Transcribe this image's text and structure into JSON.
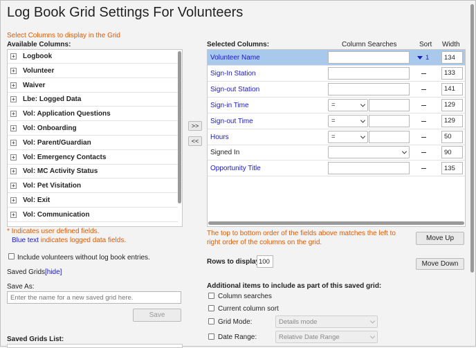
{
  "page": {
    "title": "Log Book Grid Settings For Volunteers"
  },
  "left": {
    "instruction": "Select Columns to display in the Grid",
    "available_label": "Available Columns:",
    "available_items": [
      "Logbook",
      "Volunteer",
      "Waiver",
      "Lbe: Logged Data",
      "Vol: Application Questions",
      "Vol: Onboarding",
      "Vol: Parent/Guardian",
      "Vol: Emergency Contacts",
      "Vol: MC Activity Status",
      "Vol: Pet Visitation",
      "Vol: Exit",
      "Vol: Communication"
    ],
    "note_user_defined": "* Indicates user defined fields.",
    "note_blue_text": "Blue text",
    "note_logged": " indicates logged data fields.",
    "include_without_entries_label": "Include volunteers without log book entries.",
    "saved_grids_label": "Saved Grids",
    "hide_link": "[hide]",
    "save_as_label": "Save As:",
    "save_as_placeholder": "Enter the name for a new saved grid here.",
    "save_button": "Save",
    "saved_grids_list_label": "Saved Grids List:"
  },
  "move_buttons": {
    "add": ">>",
    "remove": "<<"
  },
  "right": {
    "selected_label": "Selected Columns:",
    "headers": {
      "searches": "Column Searches",
      "sort": "Sort",
      "width": "Width"
    },
    "rows": [
      {
        "name": "Volunteer Name",
        "logged": true,
        "search": "text",
        "sort": "1",
        "width": "134",
        "selected": true
      },
      {
        "name": "Sign-In Station",
        "logged": true,
        "search": "text",
        "width": "133"
      },
      {
        "name": "Sign-out Station",
        "logged": true,
        "search": "text",
        "width": "141"
      },
      {
        "name": "Sign-in Time",
        "logged": true,
        "search": "op",
        "op": "=",
        "width": "129"
      },
      {
        "name": "Sign-out Time",
        "logged": true,
        "search": "op",
        "op": "=",
        "width": "129"
      },
      {
        "name": "Hours",
        "logged": true,
        "search": "op",
        "op": "=",
        "width": "50"
      },
      {
        "name": "Signed In",
        "logged": false,
        "search": "select",
        "width": "90"
      },
      {
        "name": "Opportunity Title",
        "logged": true,
        "search": "text",
        "width": "135"
      }
    ],
    "order_note": "The top to bottom order of the fields above matches the left to right order of the columns on the grid.",
    "move_up": "Move Up",
    "move_down": "Move Down",
    "rows_to_display_label": "Rows to display:",
    "rows_to_display_value": "100",
    "additional_label": "Additional items to include as part of this saved grid:",
    "opt_column_searches": "Column searches",
    "opt_current_sort": "Current column sort",
    "opt_grid_mode": "Grid Mode:",
    "grid_mode_value": "Details mode",
    "opt_date_range": "Date Range:",
    "date_range_value": "Relative Date Range"
  },
  "colors": {
    "accent_orange": "#e05a00",
    "logged_blue": "#1818c8",
    "selected_row": "#a9c9ec"
  }
}
